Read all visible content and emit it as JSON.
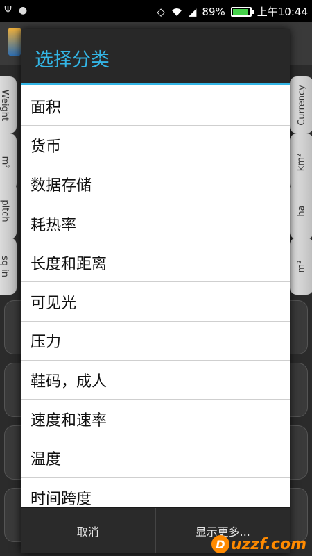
{
  "statusbar": {
    "battery_text": "89%",
    "time": "上午10:44",
    "battery_level": 0.89
  },
  "background": {
    "left_tabs": [
      "Weight",
      "m²",
      "pitch",
      "sq in"
    ],
    "right_tabs": [
      "Currency",
      "km²",
      "ha",
      "m²"
    ]
  },
  "dialog": {
    "title": "选择分类",
    "items": [
      "面积",
      "货币",
      "数据存储",
      "耗热率",
      "长度和距离",
      "可见光",
      "压力",
      "鞋码，成人",
      "速度和速率",
      "温度",
      "时间跨度"
    ],
    "cancel_label": "取消",
    "more_label": "显示更多..."
  },
  "watermark": {
    "text": "uzzf.com"
  }
}
